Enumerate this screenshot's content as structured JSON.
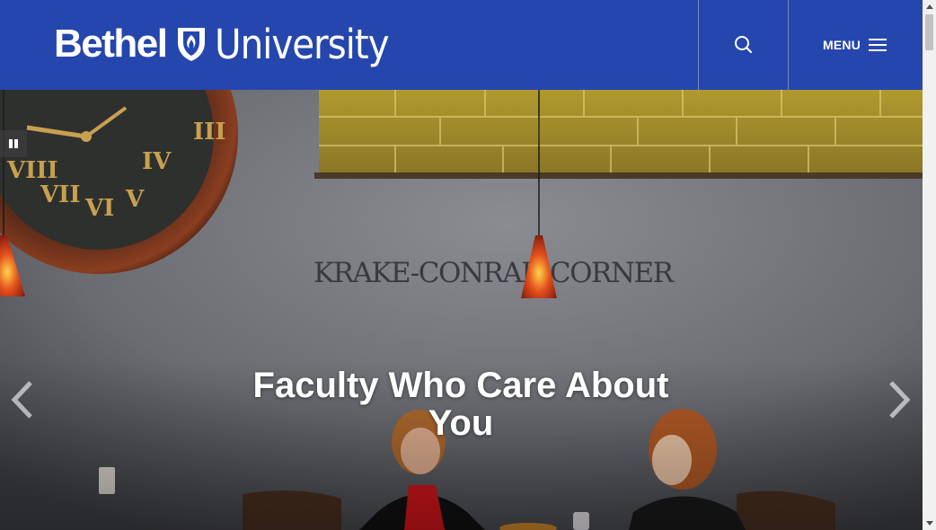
{
  "header": {
    "logo_word_1": "Bethel",
    "logo_word_2": "University",
    "search_icon": "search-icon",
    "menu_label": "MENU",
    "menu_icon": "hamburger-icon",
    "background_color": "#2546ad"
  },
  "hero": {
    "sign_text": "KRAKE-CONRAD CORNER",
    "title": "Faculty Who Care About You",
    "pause_icon": "pause-icon",
    "prev_icon": "chevron-left-icon",
    "next_icon": "chevron-right-icon"
  },
  "scrollbar": {
    "up_icon": "scroll-up-arrow-icon",
    "down_icon": "scroll-down-arrow-icon"
  }
}
